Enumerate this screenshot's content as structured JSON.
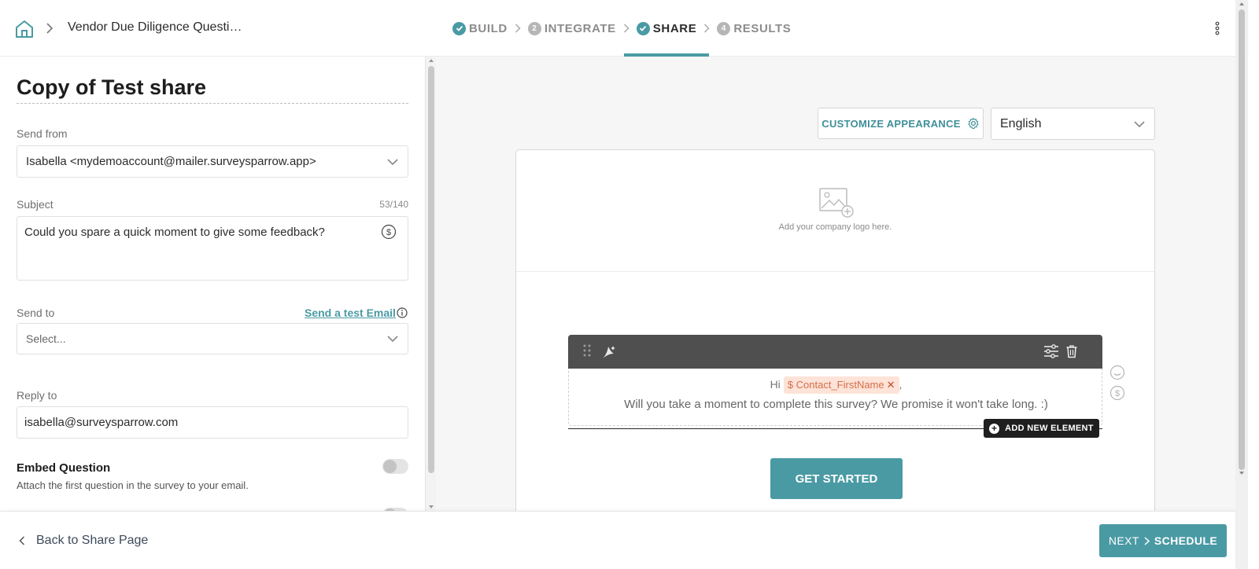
{
  "header": {
    "breadcrumb_title": "Vendor Due Diligence Questi…",
    "steps": [
      {
        "label": "BUILD",
        "state": "done",
        "number": ""
      },
      {
        "label": "INTEGRATE",
        "state": "pending",
        "number": "2"
      },
      {
        "label": "SHARE",
        "state": "active",
        "number": ""
      },
      {
        "label": "RESULTS",
        "state": "pending",
        "number": "4"
      }
    ]
  },
  "form": {
    "title": "Copy of Test share",
    "send_from": {
      "label": "Send from",
      "value": "Isabella <mydemoaccount@mailer.surveysparrow.app>"
    },
    "subject": {
      "label": "Subject",
      "counter": "53/140",
      "value": "Could you spare a quick moment to give some feedback?"
    },
    "send_to": {
      "label": "Send to",
      "test_link": "Send a test Email",
      "placeholder": "Select..."
    },
    "reply_to": {
      "label": "Reply to",
      "value": "isabella@surveysparrow.com"
    },
    "embed": {
      "title": "Embed Question",
      "description": "Attach the first question in the survey to your email."
    }
  },
  "preview": {
    "customize_label": "CUSTOMIZE APPEARANCE",
    "language": "English",
    "logo_hint": "Add your company logo here.",
    "greeting": "Hi",
    "variable_tag": "$ Contact_FirstName",
    "greeting_suffix": ",",
    "message": "Will you take a moment to complete this survey? We promise it won't take long. :)",
    "add_element_label": "ADD NEW ELEMENT",
    "cta_label": "GET STARTED"
  },
  "footer": {
    "back_label": "Back to Share Page",
    "next_label": "NEXT",
    "schedule_label": "SCHEDULE"
  },
  "colors": {
    "accent": "#4a9aa4",
    "tag_bg": "#fde3d8",
    "toolbar_bg": "#4f4f4f"
  }
}
